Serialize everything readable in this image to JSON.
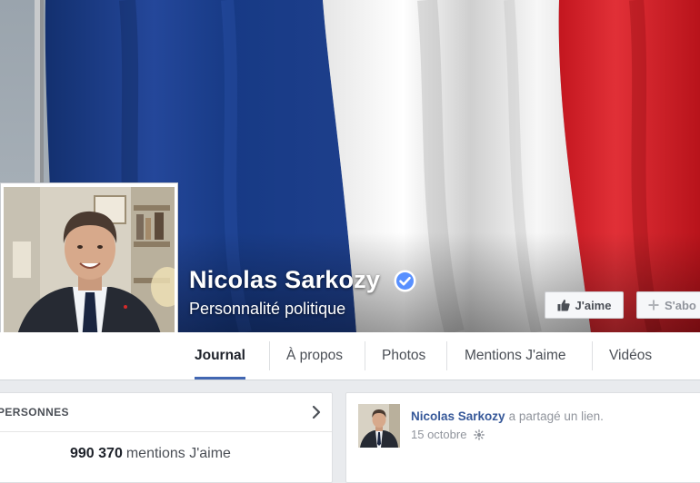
{
  "profile": {
    "name": "Nicolas Sarkozy",
    "category": "Personnalité politique",
    "verified_color": "#5890ff"
  },
  "actions": {
    "like_label": "J'aime",
    "subscribe_label": "S'abo"
  },
  "tabs": [
    {
      "label": "Journal",
      "active": true
    },
    {
      "label": "À propos"
    },
    {
      "label": "Photos"
    },
    {
      "label": "Mentions J'aime"
    },
    {
      "label": "Vidéos"
    }
  ],
  "people_card": {
    "header": "PERSONNES",
    "likes_count": "990 370",
    "likes_label": "mentions J'aime"
  },
  "post": {
    "author": "Nicolas Sarkozy",
    "action": "a partagé un lien.",
    "date": "15 octobre",
    "privacy_icon": "globe-icon"
  },
  "colors": {
    "flag_blue": "#1d3b83",
    "flag_white": "#f2f2f2",
    "flag_red": "#d7262c",
    "tab_underline": "#4267b2",
    "link": "#365899"
  }
}
